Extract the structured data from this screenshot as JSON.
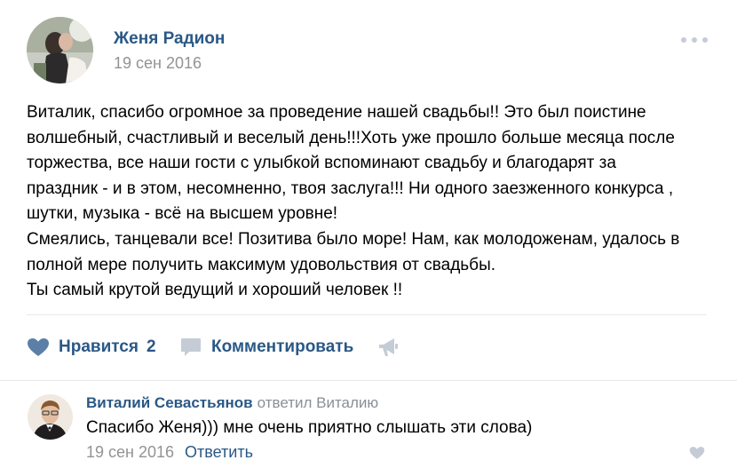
{
  "post": {
    "author_name": "Женя Радион",
    "date": "19 сен 2016",
    "text_lines": [
      "Виталик, спасибо огромное за проведение нашей свадьбы!! Это был поистине",
      "волшебный, счастливый и веселый день!!!Хоть уже прошло больше месяца после",
      "торжества, все наши гости с улыбкой вспоминают свадьбу и благодарят за",
      "праздник - и в этом, несомненно, твоя заслуга!!! Ни одного заезженного конкурса ,",
      "шутки, музыка - всё на высшем уровне!",
      "Смеялись, танцевали все! Позитива было море! Нам, как молодоженам, удалось в",
      "полной мере получить максимум удовольствия от свадьбы.",
      "Ты самый крутой ведущий и хороший человек !!"
    ],
    "more_icon": "more-dots-icon"
  },
  "actions": {
    "like_label": "Нравится",
    "like_count": "2",
    "like_icon": "heart-icon",
    "comment_label": "Комментировать",
    "comment_icon": "speech-bubble-icon",
    "share_icon": "megaphone-icon"
  },
  "reply": {
    "author_name": "Виталий Севастьянов",
    "replied_to": "ответил Виталию",
    "text": "Спасибо Женя))) мне очень приятно слышать эти слова)",
    "date": "19 сен 2016",
    "reply_label": "Ответить",
    "like_icon": "heart-icon"
  },
  "colors": {
    "link": "#2a5885",
    "muted": "#939393",
    "icon": "#5b7fa6",
    "icon_light": "#c5ccd6",
    "divider": "#e7e8ec"
  }
}
